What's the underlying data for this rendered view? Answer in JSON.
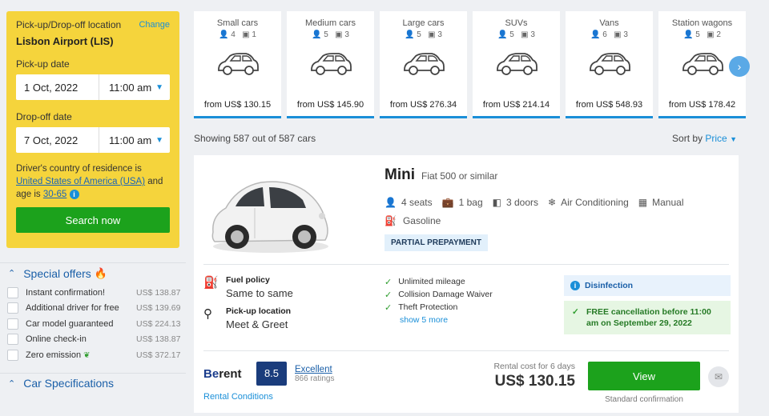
{
  "search": {
    "location_label": "Pick-up/Drop-off location",
    "change_label": "Change",
    "location": "Lisbon Airport (LIS)",
    "pickup_label": "Pick-up date",
    "pickup_date": "1 Oct, 2022",
    "pickup_time": "11:00 am",
    "dropoff_label": "Drop-off date",
    "dropoff_date": "7 Oct, 2022",
    "dropoff_time": "11:00 am",
    "country_prefix": "Driver's country of residence is",
    "country": "United States of America (USA)",
    "age_prefix": "and age is",
    "age": "30-65",
    "search_button": "Search now"
  },
  "filters": {
    "special_offers": {
      "title": "Special offers",
      "items": [
        {
          "name": "Instant confirmation!",
          "price": "US$ 138.87"
        },
        {
          "name": "Additional driver for free",
          "price": "US$ 139.69"
        },
        {
          "name": "Car model guaranteed",
          "price": "US$ 224.13"
        },
        {
          "name": "Online check-in",
          "price": "US$ 138.87"
        },
        {
          "name": "Zero emission",
          "price": "US$ 372.17"
        }
      ]
    },
    "car_specs": {
      "title": "Car Specifications"
    }
  },
  "car_types": [
    {
      "name": "Small cars",
      "seats": "4",
      "bags": "1",
      "price": "from US$ 130.15"
    },
    {
      "name": "Medium cars",
      "seats": "5",
      "bags": "3",
      "price": "from US$ 145.90"
    },
    {
      "name": "Large cars",
      "seats": "5",
      "bags": "3",
      "price": "from US$ 276.34"
    },
    {
      "name": "SUVs",
      "seats": "5",
      "bags": "3",
      "price": "from US$ 214.14"
    },
    {
      "name": "Vans",
      "seats": "6",
      "bags": "3",
      "price": "from US$ 548.93"
    },
    {
      "name": "Station wagons",
      "seats": "5",
      "bags": "2",
      "price": "from US$ 178.42"
    }
  ],
  "results": {
    "showing": "Showing 587 out of 587 cars",
    "sort_label": "Sort by",
    "sort_value": "Price"
  },
  "card": {
    "name": "Mini",
    "similar": "Fiat 500 or similar",
    "seats": "4 seats",
    "bags": "1 bag",
    "doors": "3 doors",
    "ac": "Air Conditioning",
    "transmission": "Manual",
    "fuel": "Gasoline",
    "badge": "PARTIAL PREPAYMENT",
    "fuel_policy_label": "Fuel policy",
    "fuel_policy": "Same to same",
    "pickup_loc_label": "Pick-up location",
    "pickup_loc": "Meet & Greet",
    "included": [
      "Unlimited mileage",
      "Collision Damage Waiver",
      "Theft Protection"
    ],
    "show_more": "show 5 more",
    "disinfection": "Disinfection",
    "free_cancel": "FREE cancellation before 11:00 am on September 29, 2022",
    "supplier_logo_1": "Be",
    "supplier_logo_2": "rent",
    "score": "8.5",
    "rating_label": "Excellent",
    "rating_count": "866 ratings",
    "rental_conditions": "Rental Conditions",
    "cost_label": "Rental cost for 6 days",
    "price": "US$ 130.15",
    "view_button": "View",
    "std_conf": "Standard confirmation"
  },
  "colors": {
    "accent": "#1a8fd8",
    "search_panel": "#f5d43c",
    "primary_button": "#1ca21c"
  }
}
